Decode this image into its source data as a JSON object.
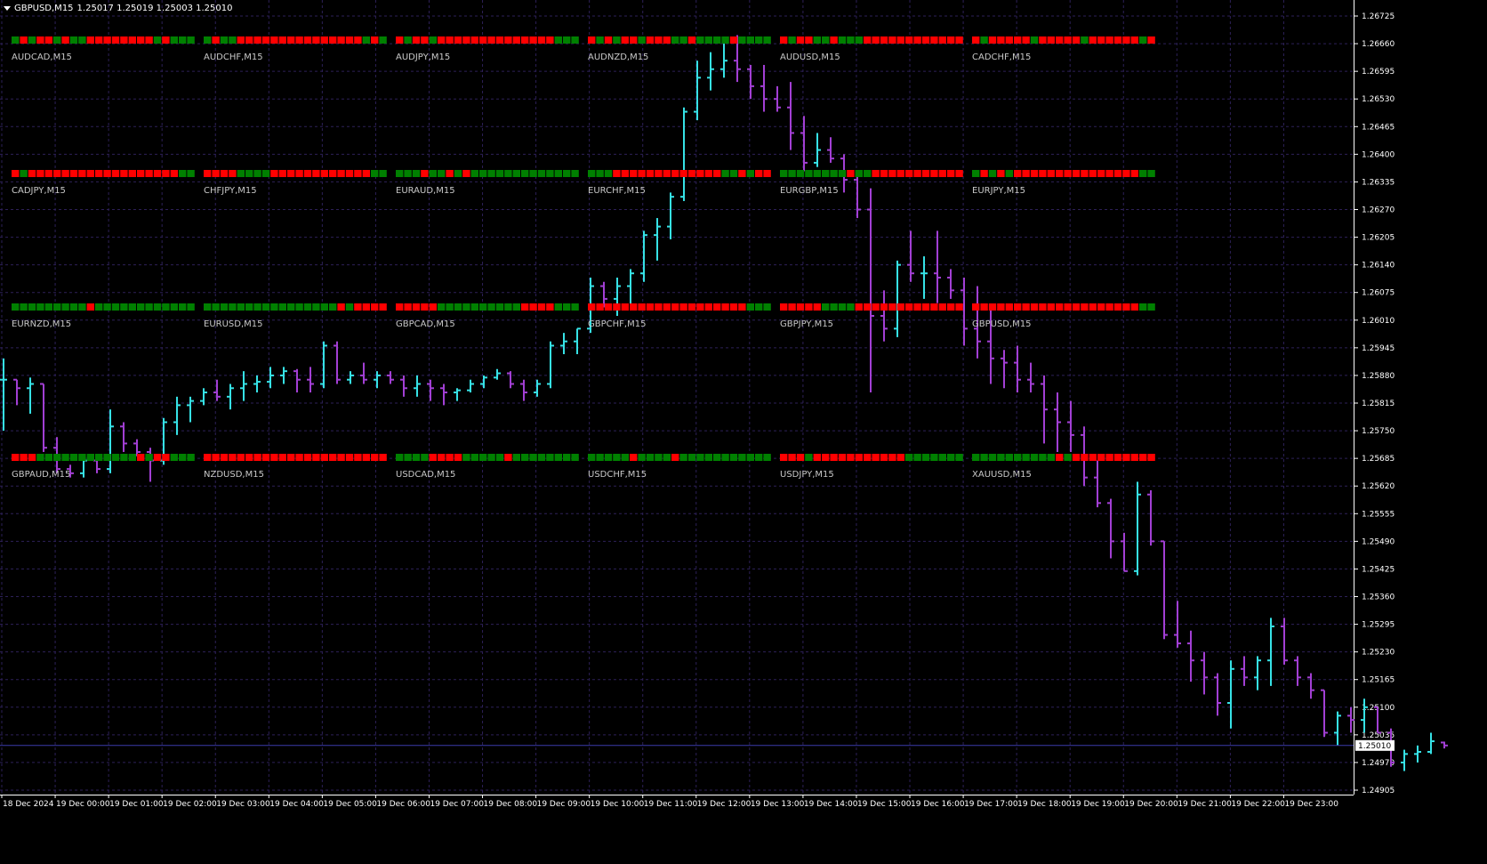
{
  "window": {
    "symbol": "GBPUSD,M15",
    "ohlc": "1.25017 1.25019 1.25003 1.25010"
  },
  "colors": {
    "background": "#000000",
    "grid": "#2d2058",
    "bull": "#36e2e6",
    "bear": "#a23fd4",
    "box_red": "#ff0000",
    "box_green": "#008000",
    "axis_text": "#ffffff",
    "label_text": "#c8c8c8",
    "current_line": "#3a3aaa"
  },
  "price_axis": {
    "labels": [
      "1.26725",
      "1.26660",
      "1.26595",
      "1.26530",
      "1.26465",
      "1.26400",
      "1.26335",
      "1.26270",
      "1.26205",
      "1.26140",
      "1.26075",
      "1.26010",
      "1.25945",
      "1.25880",
      "1.25815",
      "1.25750",
      "1.25685",
      "1.25620",
      "1.25555",
      "1.25490",
      "1.25425",
      "1.25360",
      "1.25295",
      "1.25230",
      "1.25165",
      "1.25100",
      "1.25035",
      "1.24970",
      "1.24905"
    ],
    "current_price": "1.25010"
  },
  "time_axis": {
    "labels": [
      "18 Dec 2024",
      "19 Dec 00:00",
      "19 Dec 01:00",
      "19 Dec 02:00",
      "19 Dec 03:00",
      "19 Dec 04:00",
      "19 Dec 05:00",
      "19 Dec 06:00",
      "19 Dec 07:00",
      "19 Dec 08:00",
      "19 Dec 09:00",
      "19 Dec 10:00",
      "19 Dec 11:00",
      "19 Dec 12:00",
      "19 Dec 13:00",
      "19 Dec 14:00",
      "19 Dec 15:00",
      "19 Dec 16:00",
      "19 Dec 17:00",
      "19 Dec 18:00",
      "19 Dec 19:00",
      "19 Dec 20:00",
      "19 Dec 21:00",
      "19 Dec 22:00",
      "19 Dec 23:00"
    ]
  },
  "panels": [
    {
      "label": "AUDCAD,M15",
      "boxes": "GRGRRGRGGRRRRRRRRGRGGG"
    },
    {
      "label": "AUDCHF,M15",
      "boxes": "GRGGRRRRRRRRRRRRRRRGRG"
    },
    {
      "label": "AUDJPY,M15",
      "boxes": "RGRRGRRRRRRRRRRRRRRGGG"
    },
    {
      "label": "AUDNZD,M15",
      "boxes": "RGRGRRGRRRGGRGGGGRGGGG"
    },
    {
      "label": "AUDUSD,M15",
      "boxes": "RGRRGGRGGGRRRRRRRRRRRR"
    },
    {
      "label": "CADCHF,M15",
      "boxes": "RGRRRRRGRRRRRGRRRRRRGR"
    },
    {
      "label": "CADJPY,M15",
      "boxes": "RGRRRRRRRRRRRRRRRRRRGG"
    },
    {
      "label": "CHFJPY,M15",
      "boxes": "RRRRGGGGRRRRRRRRRRRRGG"
    },
    {
      "label": "EURAUD,M15",
      "boxes": "GGGRGGRGRGGGGGGGGGGGGG"
    },
    {
      "label": "EURCHF,M15",
      "boxes": "GGGRRRRRRRRRRRRRGGRGRR"
    },
    {
      "label": "EURGBP,M15",
      "boxes": "GGGGGGGGRGGRRRRRRRRRRR"
    },
    {
      "label": "EURJPY,M15",
      "boxes": "GRGRGRRRRRRRRRRRRRRRGG"
    },
    {
      "label": "EURNZD,M15",
      "boxes": "GGGGGGGGGRGGGGGGGGGGGG"
    },
    {
      "label": "EURUSD,M15",
      "boxes": "GGGGGGGGGGGGGGGGRGRRRR"
    },
    {
      "label": "GBPCAD,M15",
      "boxes": "RRRRRGGGGGGGGGGRRRRGGG"
    },
    {
      "label": "GBPCHF,M15",
      "boxes": "RRRRRRRRRRRRRRRRRRRGGG"
    },
    {
      "label": "GBPJPY,M15",
      "boxes": "RRRRRGGGGRRRRRRRRRRRRR"
    },
    {
      "label": "GBPUSD,M15",
      "boxes": "RRRRRRRRRRRRRRRRRRRRGG"
    },
    {
      "label": "GBPAUD,M15",
      "boxes": "RRRGGGGGGGGGGGGRGRRGGG"
    },
    {
      "label": "NZDUSD,M15",
      "boxes": "RRRRRRRRRRRRRRRRRRRRRR"
    },
    {
      "label": "USDCAD,M15",
      "boxes": "GGGGRRRRGGGGGRGGGGGGGG"
    },
    {
      "label": "USDCHF,M15",
      "boxes": "GGGGGRGGGGRGGGGGGGGGGG"
    },
    {
      "label": "USDJPY,M15",
      "boxes": "RRRGRRRRRRRRRRRGGGGGGG"
    },
    {
      "label": "XAUUSD,M15",
      "boxes": "GGGGGGGGGGRGRRRRRRRRRR"
    }
  ],
  "chart_data": {
    "type": "ohlc",
    "symbol": "GBPUSD",
    "timeframe": "M15",
    "ylim": [
      1.24905,
      1.26725
    ],
    "bars": [
      {
        "t": "18 Dec 23:45",
        "o": 1.2587,
        "h": 1.2592,
        "l": 1.2575,
        "c": 1.2587
      },
      {
        "t": "19 Dec 00:00",
        "o": 1.2587,
        "h": 1.2587,
        "l": 1.2581,
        "c": 1.2585
      },
      {
        "t": "19 Dec 00:15",
        "o": 1.2585,
        "h": 1.25875,
        "l": 1.2579,
        "c": 1.2586
      },
      {
        "t": "19 Dec 00:30",
        "o": 1.2586,
        "h": 1.2586,
        "l": 1.257,
        "c": 1.2571
      },
      {
        "t": "19 Dec 00:45",
        "o": 1.2571,
        "h": 1.25735,
        "l": 1.2565,
        "c": 1.2566
      },
      {
        "t": "19 Dec 01:00",
        "o": 1.2566,
        "h": 1.2567,
        "l": 1.2564,
        "c": 1.2565
      },
      {
        "t": "19 Dec 01:15",
        "o": 1.2565,
        "h": 1.2569,
        "l": 1.2564,
        "c": 1.2568
      },
      {
        "t": "19 Dec 01:30",
        "o": 1.2568,
        "h": 1.2569,
        "l": 1.2565,
        "c": 1.2566
      },
      {
        "t": "19 Dec 01:45",
        "o": 1.2566,
        "h": 1.258,
        "l": 1.2565,
        "c": 1.2576
      },
      {
        "t": "19 Dec 02:00",
        "o": 1.2576,
        "h": 1.2577,
        "l": 1.257,
        "c": 1.2572
      },
      {
        "t": "19 Dec 02:15",
        "o": 1.2572,
        "h": 1.2573,
        "l": 1.2569,
        "c": 1.257
      },
      {
        "t": "19 Dec 02:30",
        "o": 1.257,
        "h": 1.2571,
        "l": 1.2563,
        "c": 1.2568
      },
      {
        "t": "19 Dec 02:45",
        "o": 1.2568,
        "h": 1.2578,
        "l": 1.2567,
        "c": 1.2577
      },
      {
        "t": "19 Dec 03:00",
        "o": 1.2577,
        "h": 1.2583,
        "l": 1.2574,
        "c": 1.2581
      },
      {
        "t": "19 Dec 03:15",
        "o": 1.2581,
        "h": 1.2583,
        "l": 1.2577,
        "c": 1.2582
      },
      {
        "t": "19 Dec 03:30",
        "o": 1.2582,
        "h": 1.2585,
        "l": 1.2581,
        "c": 1.2584
      },
      {
        "t": "19 Dec 03:45",
        "o": 1.2584,
        "h": 1.2587,
        "l": 1.2582,
        "c": 1.2583
      },
      {
        "t": "19 Dec 04:00",
        "o": 1.2583,
        "h": 1.2586,
        "l": 1.258,
        "c": 1.2585
      },
      {
        "t": "19 Dec 04:15",
        "o": 1.2585,
        "h": 1.2589,
        "l": 1.2582,
        "c": 1.2586
      },
      {
        "t": "19 Dec 04:30",
        "o": 1.2586,
        "h": 1.2588,
        "l": 1.2584,
        "c": 1.25865
      },
      {
        "t": "19 Dec 04:45",
        "o": 1.25865,
        "h": 1.259,
        "l": 1.2585,
        "c": 1.2588
      },
      {
        "t": "19 Dec 05:00",
        "o": 1.2588,
        "h": 1.259,
        "l": 1.2586,
        "c": 1.2589
      },
      {
        "t": "19 Dec 05:15",
        "o": 1.2589,
        "h": 1.25895,
        "l": 1.2584,
        "c": 1.2587
      },
      {
        "t": "19 Dec 05:30",
        "o": 1.2587,
        "h": 1.259,
        "l": 1.2584,
        "c": 1.2586
      },
      {
        "t": "19 Dec 05:45",
        "o": 1.2586,
        "h": 1.2596,
        "l": 1.2585,
        "c": 1.2595
      },
      {
        "t": "19 Dec 06:00",
        "o": 1.2595,
        "h": 1.2596,
        "l": 1.2586,
        "c": 1.2587
      },
      {
        "t": "19 Dec 06:15",
        "o": 1.2587,
        "h": 1.2589,
        "l": 1.2586,
        "c": 1.2588
      },
      {
        "t": "19 Dec 06:30",
        "o": 1.2588,
        "h": 1.2591,
        "l": 1.2586,
        "c": 1.2587
      },
      {
        "t": "19 Dec 06:45",
        "o": 1.2587,
        "h": 1.2589,
        "l": 1.2585,
        "c": 1.2588
      },
      {
        "t": "19 Dec 07:00",
        "o": 1.2588,
        "h": 1.2589,
        "l": 1.2586,
        "c": 1.2587
      },
      {
        "t": "19 Dec 07:15",
        "o": 1.2587,
        "h": 1.2588,
        "l": 1.2583,
        "c": 1.2585
      },
      {
        "t": "19 Dec 07:30",
        "o": 1.2585,
        "h": 1.2588,
        "l": 1.2583,
        "c": 1.2586
      },
      {
        "t": "19 Dec 07:45",
        "o": 1.2586,
        "h": 1.2587,
        "l": 1.2582,
        "c": 1.2585
      },
      {
        "t": "19 Dec 08:00",
        "o": 1.2585,
        "h": 1.2586,
        "l": 1.2581,
        "c": 1.2584
      },
      {
        "t": "19 Dec 08:15",
        "o": 1.2584,
        "h": 1.2585,
        "l": 1.2582,
        "c": 1.25845
      },
      {
        "t": "19 Dec 08:30",
        "o": 1.25845,
        "h": 1.2587,
        "l": 1.2584,
        "c": 1.2586
      },
      {
        "t": "19 Dec 08:45",
        "o": 1.2586,
        "h": 1.2588,
        "l": 1.2585,
        "c": 1.25875
      },
      {
        "t": "19 Dec 09:00",
        "o": 1.25875,
        "h": 1.25895,
        "l": 1.2587,
        "c": 1.25885
      },
      {
        "t": "19 Dec 09:15",
        "o": 1.25885,
        "h": 1.2589,
        "l": 1.2585,
        "c": 1.2586
      },
      {
        "t": "19 Dec 09:30",
        "o": 1.2586,
        "h": 1.2587,
        "l": 1.2582,
        "c": 1.2584
      },
      {
        "t": "19 Dec 09:45",
        "o": 1.2584,
        "h": 1.2587,
        "l": 1.2583,
        "c": 1.2586
      },
      {
        "t": "19 Dec 10:00",
        "o": 1.2586,
        "h": 1.2596,
        "l": 1.2585,
        "c": 1.2595
      },
      {
        "t": "19 Dec 10:15",
        "o": 1.2595,
        "h": 1.2598,
        "l": 1.2593,
        "c": 1.2596
      },
      {
        "t": "19 Dec 10:30",
        "o": 1.2596,
        "h": 1.2599,
        "l": 1.2593,
        "c": 1.2599
      },
      {
        "t": "19 Dec 10:45",
        "o": 1.2599,
        "h": 1.2611,
        "l": 1.2598,
        "c": 1.2609
      },
      {
        "t": "19 Dec 11:00",
        "o": 1.2609,
        "h": 1.261,
        "l": 1.2604,
        "c": 1.2606
      },
      {
        "t": "19 Dec 11:15",
        "o": 1.2606,
        "h": 1.2611,
        "l": 1.2602,
        "c": 1.2609
      },
      {
        "t": "19 Dec 11:30",
        "o": 1.2609,
        "h": 1.2613,
        "l": 1.2604,
        "c": 1.2612
      },
      {
        "t": "19 Dec 11:45",
        "o": 1.2612,
        "h": 1.2622,
        "l": 1.261,
        "c": 1.2621
      },
      {
        "t": "19 Dec 12:00",
        "o": 1.2621,
        "h": 1.2625,
        "l": 1.2615,
        "c": 1.2623
      },
      {
        "t": "19 Dec 12:15",
        "o": 1.2623,
        "h": 1.2631,
        "l": 1.262,
        "c": 1.263
      },
      {
        "t": "19 Dec 12:30",
        "o": 1.263,
        "h": 1.2651,
        "l": 1.2629,
        "c": 1.265
      },
      {
        "t": "19 Dec 12:45",
        "o": 1.265,
        "h": 1.2662,
        "l": 1.2648,
        "c": 1.2658
      },
      {
        "t": "19 Dec 13:00",
        "o": 1.2658,
        "h": 1.2664,
        "l": 1.2655,
        "c": 1.266
      },
      {
        "t": "19 Dec 13:15",
        "o": 1.266,
        "h": 1.2666,
        "l": 1.2658,
        "c": 1.2662
      },
      {
        "t": "19 Dec 13:30",
        "o": 1.2662,
        "h": 1.2668,
        "l": 1.2657,
        "c": 1.266
      },
      {
        "t": "19 Dec 13:45",
        "o": 1.266,
        "h": 1.2661,
        "l": 1.2653,
        "c": 1.2656
      },
      {
        "t": "19 Dec 14:00",
        "o": 1.2656,
        "h": 1.2661,
        "l": 1.265,
        "c": 1.2653
      },
      {
        "t": "19 Dec 14:15",
        "o": 1.2653,
        "h": 1.2656,
        "l": 1.265,
        "c": 1.2651
      },
      {
        "t": "19 Dec 14:30",
        "o": 1.2651,
        "h": 1.2657,
        "l": 1.2641,
        "c": 1.2645
      },
      {
        "t": "19 Dec 14:45",
        "o": 1.2645,
        "h": 1.2649,
        "l": 1.2636,
        "c": 1.2638
      },
      {
        "t": "19 Dec 15:00",
        "o": 1.2638,
        "h": 1.2645,
        "l": 1.2637,
        "c": 1.2641
      },
      {
        "t": "19 Dec 15:15",
        "o": 1.2641,
        "h": 1.2644,
        "l": 1.2638,
        "c": 1.2639
      },
      {
        "t": "19 Dec 15:30",
        "o": 1.2639,
        "h": 1.264,
        "l": 1.2631,
        "c": 1.2634
      },
      {
        "t": "19 Dec 15:45",
        "o": 1.2634,
        "h": 1.2636,
        "l": 1.2625,
        "c": 1.2627
      },
      {
        "t": "19 Dec 16:00",
        "o": 1.2627,
        "h": 1.2632,
        "l": 1.2584,
        "c": 1.2602
      },
      {
        "t": "19 Dec 16:15",
        "o": 1.2602,
        "h": 1.2608,
        "l": 1.2596,
        "c": 1.2599
      },
      {
        "t": "19 Dec 16:30",
        "o": 1.2599,
        "h": 1.2615,
        "l": 1.2597,
        "c": 1.2614
      },
      {
        "t": "19 Dec 16:45",
        "o": 1.2614,
        "h": 1.2622,
        "l": 1.261,
        "c": 1.2612
      },
      {
        "t": "19 Dec 17:00",
        "o": 1.2612,
        "h": 1.2616,
        "l": 1.2606,
        "c": 1.2612
      },
      {
        "t": "19 Dec 17:15",
        "o": 1.2612,
        "h": 1.2622,
        "l": 1.2605,
        "c": 1.2611
      },
      {
        "t": "19 Dec 17:30",
        "o": 1.2611,
        "h": 1.2613,
        "l": 1.2606,
        "c": 1.2608
      },
      {
        "t": "19 Dec 17:45",
        "o": 1.2608,
        "h": 1.2611,
        "l": 1.2595,
        "c": 1.2599
      },
      {
        "t": "19 Dec 18:00",
        "o": 1.2599,
        "h": 1.2609,
        "l": 1.2592,
        "c": 1.2596
      },
      {
        "t": "19 Dec 18:15",
        "o": 1.2596,
        "h": 1.2604,
        "l": 1.2586,
        "c": 1.2592
      },
      {
        "t": "19 Dec 18:30",
        "o": 1.2592,
        "h": 1.2594,
        "l": 1.2585,
        "c": 1.2591
      },
      {
        "t": "19 Dec 18:45",
        "o": 1.2591,
        "h": 1.2595,
        "l": 1.2584,
        "c": 1.2587
      },
      {
        "t": "19 Dec 19:00",
        "o": 1.2587,
        "h": 1.2591,
        "l": 1.2584,
        "c": 1.2586
      },
      {
        "t": "19 Dec 19:15",
        "o": 1.2586,
        "h": 1.2588,
        "l": 1.2572,
        "c": 1.258
      },
      {
        "t": "19 Dec 19:30",
        "o": 1.258,
        "h": 1.2584,
        "l": 1.257,
        "c": 1.2577
      },
      {
        "t": "19 Dec 19:45",
        "o": 1.2577,
        "h": 1.2582,
        "l": 1.257,
        "c": 1.2574
      },
      {
        "t": "19 Dec 20:00",
        "o": 1.2574,
        "h": 1.2576,
        "l": 1.2562,
        "c": 1.2564
      },
      {
        "t": "19 Dec 20:15",
        "o": 1.2564,
        "h": 1.2568,
        "l": 1.2557,
        "c": 1.2558
      },
      {
        "t": "19 Dec 20:30",
        "o": 1.2558,
        "h": 1.2559,
        "l": 1.2545,
        "c": 1.2549
      },
      {
        "t": "19 Dec 20:45",
        "o": 1.2549,
        "h": 1.2551,
        "l": 1.2542,
        "c": 1.2542
      },
      {
        "t": "19 Dec 21:00",
        "o": 1.2542,
        "h": 1.2563,
        "l": 1.2541,
        "c": 1.256
      },
      {
        "t": "19 Dec 21:15",
        "o": 1.256,
        "h": 1.2561,
        "l": 1.2548,
        "c": 1.2549
      },
      {
        "t": "19 Dec 21:30",
        "o": 1.2549,
        "h": 1.2549,
        "l": 1.2526,
        "c": 1.2527
      },
      {
        "t": "19 Dec 21:45",
        "o": 1.2527,
        "h": 1.2535,
        "l": 1.2524,
        "c": 1.2525
      },
      {
        "t": "19 Dec 22:00",
        "o": 1.2525,
        "h": 1.2528,
        "l": 1.2516,
        "c": 1.2521
      },
      {
        "t": "19 Dec 22:15",
        "o": 1.2521,
        "h": 1.2523,
        "l": 1.2513,
        "c": 1.2517
      },
      {
        "t": "19 Dec 22:30",
        "o": 1.2517,
        "h": 1.2518,
        "l": 1.2508,
        "c": 1.2511
      },
      {
        "t": "19 Dec 22:45",
        "o": 1.2511,
        "h": 1.2521,
        "l": 1.2505,
        "c": 1.2519
      },
      {
        "t": "19 Dec 23:00",
        "o": 1.2519,
        "h": 1.2522,
        "l": 1.2515,
        "c": 1.2517
      },
      {
        "t": "19 Dec 23:15",
        "o": 1.2517,
        "h": 1.2522,
        "l": 1.2514,
        "c": 1.2521
      },
      {
        "t": "19 Dec 23:30",
        "o": 1.2521,
        "h": 1.2531,
        "l": 1.2515,
        "c": 1.2529
      },
      {
        "t": "19 Dec 23:45",
        "o": 1.2529,
        "h": 1.2531,
        "l": 1.252,
        "c": 1.2521
      },
      {
        "t": "20 Dec 00:00",
        "o": 1.2521,
        "h": 1.2522,
        "l": 1.2515,
        "c": 1.2517
      },
      {
        "t": "20 Dec 00:15",
        "o": 1.2517,
        "h": 1.2518,
        "l": 1.2512,
        "c": 1.2514
      },
      {
        "t": "20 Dec 00:30",
        "o": 1.2514,
        "h": 1.2514,
        "l": 1.2503,
        "c": 1.2504
      },
      {
        "t": "20 Dec 00:45",
        "o": 1.2504,
        "h": 1.2509,
        "l": 1.2501,
        "c": 1.2508
      },
      {
        "t": "20 Dec 01:00",
        "o": 1.2508,
        "h": 1.251,
        "l": 1.2504,
        "c": 1.2507
      },
      {
        "t": "20 Dec 01:15",
        "o": 1.2507,
        "h": 1.2512,
        "l": 1.2504,
        "c": 1.251
      },
      {
        "t": "20 Dec 01:30",
        "o": 1.251,
        "h": 1.251,
        "l": 1.2504,
        "c": 1.2504
      },
      {
        "t": "20 Dec 01:45",
        "o": 1.2504,
        "h": 1.2505,
        "l": 1.2496,
        "c": 1.2497
      },
      {
        "t": "20 Dec 02:00",
        "o": 1.2497,
        "h": 1.25,
        "l": 1.2495,
        "c": 1.2499
      },
      {
        "t": "20 Dec 02:15",
        "o": 1.2499,
        "h": 1.2501,
        "l": 1.2497,
        "c": 1.24995
      },
      {
        "t": "20 Dec 02:30",
        "o": 1.24995,
        "h": 1.2504,
        "l": 1.2499,
        "c": 1.2502
      },
      {
        "t": "20 Dec 02:45",
        "o": 1.25017,
        "h": 1.25019,
        "l": 1.25003,
        "c": 1.2501
      }
    ]
  }
}
